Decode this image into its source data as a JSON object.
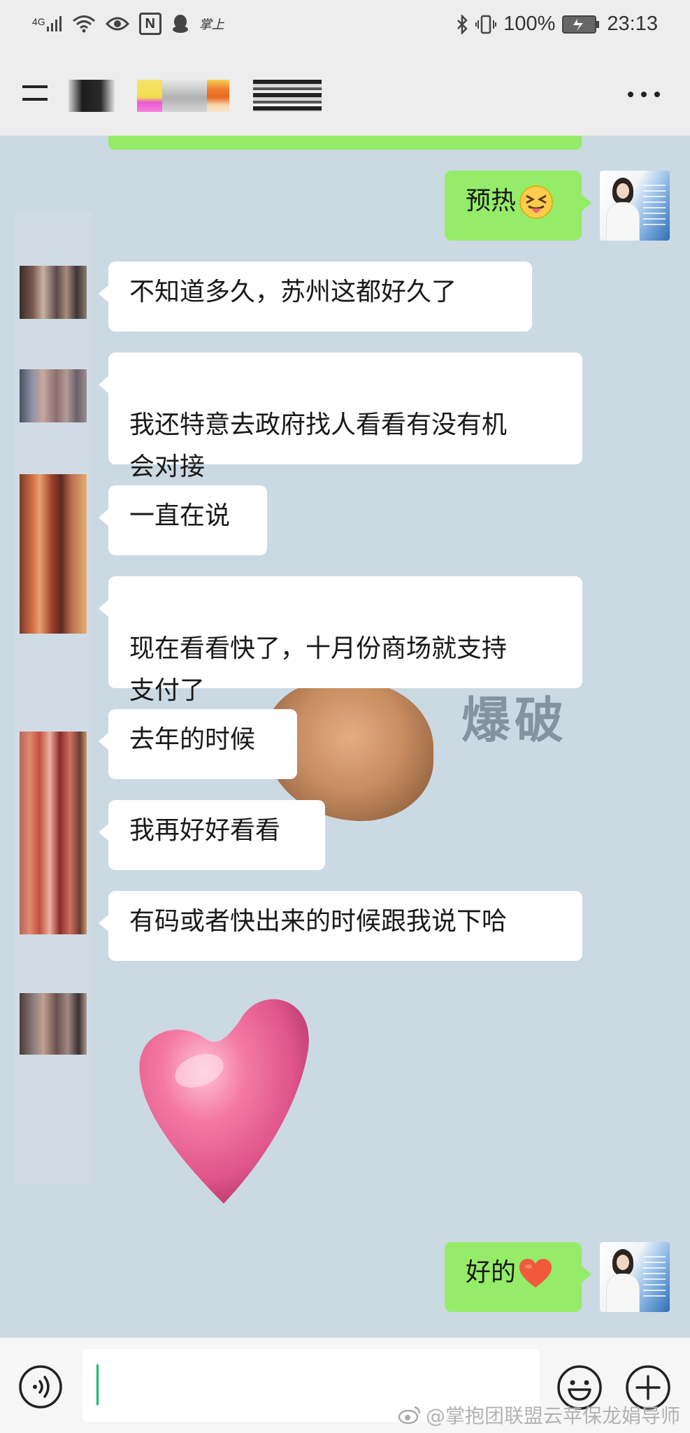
{
  "status_bar": {
    "network": "4G",
    "nfc_label": "N",
    "app_badge": "掌上",
    "battery": "100%",
    "time": "23:13"
  },
  "chat": {
    "messages": [
      {
        "side": "right",
        "text": "预热",
        "emoji": "squinting-face-with-tongue"
      },
      {
        "side": "left",
        "text": "不知道多久，苏州这都好久了"
      },
      {
        "side": "left",
        "text": "我还特意去政府找人看看有没有机\n会对接"
      },
      {
        "side": "left",
        "text": "一直在说"
      },
      {
        "side": "left",
        "text": "现在看看快了，十月份商场就支持\n支付了"
      },
      {
        "side": "left",
        "text": "去年的时候"
      },
      {
        "side": "left",
        "text": "我再好好看看"
      },
      {
        "side": "left",
        "text": "有码或者快出来的时候跟我说下哈"
      },
      {
        "side": "left",
        "sticker": "pink-heart-sticker"
      },
      {
        "side": "right",
        "text": "好的",
        "emoji": "red-heart"
      }
    ],
    "background_banner": "爆破"
  },
  "input_bar": {
    "value": "",
    "placeholder": ""
  },
  "watermark": {
    "text": "@掌抱团联盟云苹保龙娟导师"
  },
  "colors": {
    "chat_background": "#cbd9e2",
    "sent_bubble": "#95ec69",
    "received_bubble": "#ffffff",
    "header_background": "#ededed",
    "caret": "#07c160"
  }
}
